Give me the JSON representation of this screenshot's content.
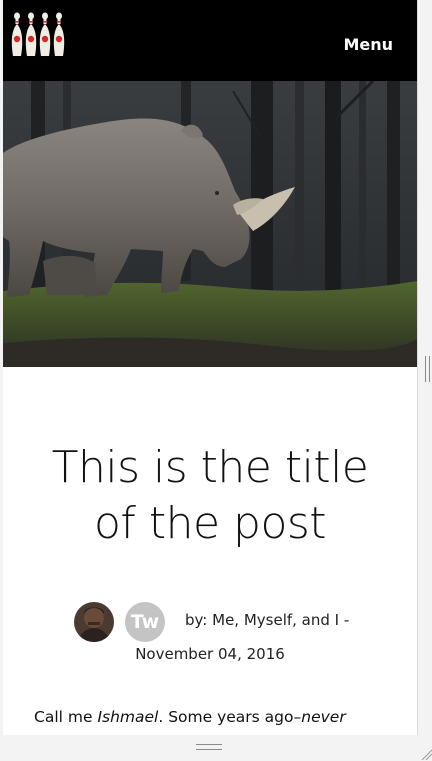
{
  "header": {
    "logo_icon": "bowling-pins-logo-icon",
    "menu_label": "Menu"
  },
  "hero": {
    "icon": "rhino-photo"
  },
  "post": {
    "title_line1": "This is the title",
    "title_line2": "of the post",
    "avatar_initials": "Tw",
    "byline": "by: Me, Myself, and I -",
    "date": "November 04, 2016",
    "body_start": "Call me ",
    "body_name": "Ishmael",
    "body_middle": ". Some years ago–",
    "body_emph": "never"
  },
  "colors": {
    "header_bg": "#000000",
    "avatar_bg": "#c4c4c4",
    "logo_accent": "#d22a2a"
  }
}
